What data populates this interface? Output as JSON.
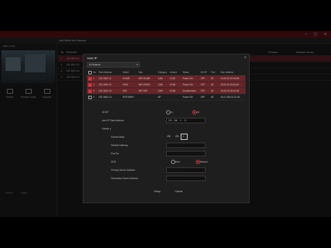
{
  "window": {
    "controls": [
      "–",
      "▢",
      "✕"
    ]
  },
  "subbar": {
    "crumb": "Add Select Not Cameras"
  },
  "left_panel": {
    "title": "Cam 1 Live",
    "buttons": [
      "Search",
      "Remote Config",
      "Upgrade"
    ],
    "footer": [
      "Search",
      "Export"
    ]
  },
  "background_table": {
    "rows": [
      {
        "idx": "No.",
        "ip": "IP/Domain",
        "status": "",
        "right1": "Firmware",
        "right2": "Hardware Version"
      },
      {
        "idx": "1",
        "ip": "192.168.0.11",
        "status": "",
        "right1": "",
        "right2": ""
      },
      {
        "idx": "2",
        "ip": "192.168.0.12",
        "status": "",
        "right1": "",
        "right2": ""
      },
      {
        "idx": "3",
        "ip": "192.168.0.13",
        "status": "",
        "right1": "",
        "right2": ""
      },
      {
        "idx": "4",
        "ip": "192.168.0.14",
        "status": "",
        "right1": "",
        "right2": ""
      }
    ]
  },
  "dialog": {
    "title": "Auto IP",
    "close": "×",
    "network_select": "All Network",
    "columns": [
      "No.",
      "Start Address",
      "Model",
      "Mac",
      "Category",
      "Version",
      "Status",
      "DHCP",
      "Port",
      "Mac Address"
    ],
    "rows": [
      {
        "no": "1",
        "ip": "192.168.0.11",
        "model": "H100B",
        "mac": "IMP-H100B",
        "cat": "CAM",
        "ver": "V3.82",
        "status": "Power ON",
        "dhcp": "OFF",
        "port": "80",
        "macaddr": "00-00-00-20-25-88",
        "checked": true,
        "selected": true
      },
      {
        "no": "2",
        "ip": "192.168.0.12",
        "model": "H300",
        "mac": "IMP-H300S",
        "cat": "CAM",
        "ver": "V3.80",
        "status": "Power ON",
        "dhcp": "OFF",
        "port": "80",
        "macaddr": "00-00-00-20-06-82",
        "checked": true,
        "selected": true
      },
      {
        "no": "3",
        "ip": "192.168.0.15",
        "model": "H50",
        "mac": "IMP-H50",
        "cat": "CAM",
        "ver": "V3.86",
        "status": "Unauthorized",
        "dhcp": "OFF",
        "port": "80",
        "macaddr": "00-00-00-00-00-08",
        "checked": true,
        "selected": true
      },
      {
        "no": "4",
        "ip": "192.168.0.13",
        "model": "ROTONEP...",
        "mac": "",
        "cat": "NP",
        "ver": "",
        "status": "Power ON",
        "dhcp": "OFF",
        "port": "80",
        "macaddr": "A0-17-59-C0-22-05",
        "checked": false,
        "selected": false
      }
    ],
    "form": {
      "dhcp_label": "DHCP",
      "dhcp_on": "on",
      "dhcp_off": "off",
      "start_label": "Auto IP Start Address",
      "start_value": "192 . 168 .  0  .  11",
      "details_label": "Details ∧",
      "subnet_label": "Subnet Mask",
      "subnet_parts": [
        "255",
        ".",
        "255",
        ".",
        "0"
      ],
      "gateway_label": "Default Gateway",
      "gateway_value": "  .     .     .",
      "port_label": "Port No.",
      "dns_label": "DNS",
      "dns_auto": "Auto",
      "dns_manual": "Manual",
      "primary_dns_label": "Primary Server Address",
      "primary_dns_value": "  .     .     .",
      "secondary_dns_label": "Secondary Server Address",
      "secondary_dns_value": "  .     .     ."
    },
    "buttons": {
      "setup": "Setup",
      "cancel": "Cancel"
    }
  },
  "colors": {
    "accent": "#d23540",
    "selected_row": "#6a2428",
    "topbar": "#4a0f14"
  }
}
